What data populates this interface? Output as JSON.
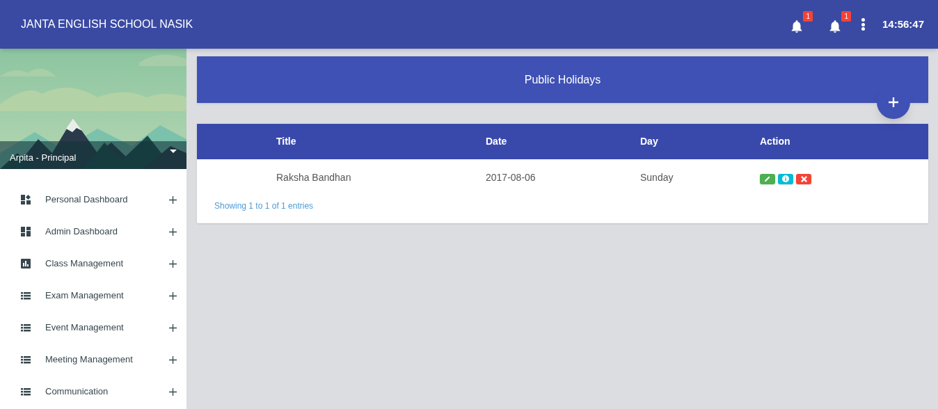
{
  "header": {
    "title": "JANTA ENGLISH SCHOOL NASIK",
    "notifications": [
      {
        "count": "1"
      },
      {
        "count": "1"
      }
    ],
    "time": "14:56:47"
  },
  "sidebar": {
    "profile": {
      "kind": "picture",
      "user": "Arpita - Principal"
    },
    "items": [
      {
        "label": "Personal Dashboard",
        "kind": "personal",
        "expanded": false
      },
      {
        "label": "Admin Dashboard",
        "kind": "dashboard",
        "expanded": false
      },
      {
        "label": "Class Management",
        "kind": "chart",
        "expanded": false
      },
      {
        "label": "Exam Management",
        "kind": "list",
        "expanded": false
      },
      {
        "label": "Event Management",
        "kind": "list",
        "expanded": false
      },
      {
        "label": "Meeting Management",
        "kind": "list",
        "expanded": false
      },
      {
        "label": "Communication",
        "kind": "list",
        "expanded": false
      }
    ]
  },
  "panel": {
    "title": "Public Holidays"
  },
  "table": {
    "columns": [
      "Title",
      "Date",
      "Day",
      "Action"
    ],
    "rows": [
      {
        "cells": [
          "Raksha Bandhan",
          "2017-08-06",
          "Sunday"
        ],
        "actions": [
          {
            "kind": "edit"
          },
          {
            "kind": "info"
          },
          {
            "kind": "delete"
          }
        ]
      }
    ],
    "footer": "Showing 1 to 1 of 1 entries"
  }
}
